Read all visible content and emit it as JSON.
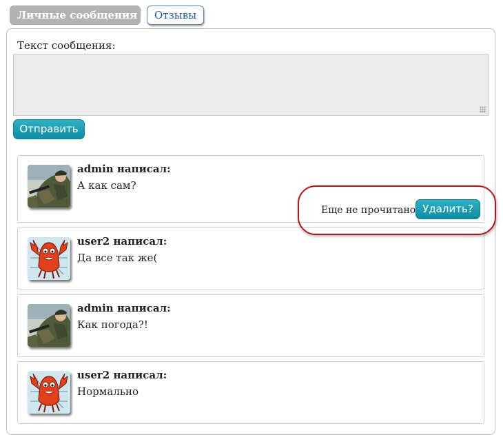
{
  "tabs": [
    {
      "label": "Личные сообщения",
      "active": true
    },
    {
      "label": "Отзывы",
      "active": false
    }
  ],
  "compose": {
    "label": "Текст сообщения:",
    "value": "",
    "send_label": "Отправить"
  },
  "messages": [
    {
      "author": "admin написал:",
      "text": "А как сам?",
      "avatar": "soldier-avatar",
      "status": "Еще не прочитано",
      "delete_label": "Удалить?"
    },
    {
      "author": "user2 написал:",
      "text": "Да все так же(",
      "avatar": "red-crab-avatar"
    },
    {
      "author": "admin написал:",
      "text": "Как погода?!",
      "avatar": "soldier-avatar"
    },
    {
      "author": "user2 написал:",
      "text": "Нормально",
      "avatar": "red-crab-avatar"
    }
  ],
  "colors": {
    "accent_button": "#1a9fb4",
    "tab_active_bg": "#b3b3b3",
    "tab_link": "#1e5aa0",
    "highlight": "#b01420"
  }
}
